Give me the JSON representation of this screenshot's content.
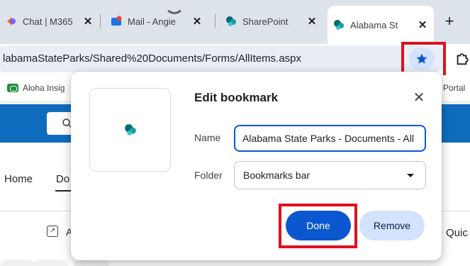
{
  "tabs": [
    {
      "title": "Chat | M365",
      "close": "✕"
    },
    {
      "title": "Mail - Angie",
      "close": "✕"
    },
    {
      "title": "SharePoint",
      "close": "✕"
    },
    {
      "title": "Alabama St",
      "close": "✕",
      "active": true
    }
  ],
  "new_tab_label": "+",
  "omnibox": {
    "url": "labamaStateParks/Shared%20Documents/Forms/AllItems.aspx"
  },
  "bookmarks_bar": [
    {
      "label": "Aloha Insig"
    },
    {
      "label": "Portal"
    }
  ],
  "page": {
    "nav": [
      "Home",
      "Do"
    ],
    "toolbar_fragment": "A",
    "right_fragment": "Quic"
  },
  "dialog": {
    "title": "Edit bookmark",
    "close": "✕",
    "name_label": "Name",
    "name_value": "Alabama State Parks - Documents - All Documents",
    "folder_label": "Folder",
    "folder_value": "Bookmarks bar",
    "done_label": "Done",
    "remove_label": "Remove"
  },
  "colors": {
    "accent_blue": "#0b57d0",
    "star_bg": "#d3e3fd",
    "highlight_red": "#e10f1e",
    "sharepoint_teal": "#038387",
    "banner_blue": "#0f6cbd"
  },
  "icons": {
    "star": "star-filled-icon",
    "sharepoint": "sharepoint-icon",
    "extensions": "extension-puzzle-icon"
  }
}
